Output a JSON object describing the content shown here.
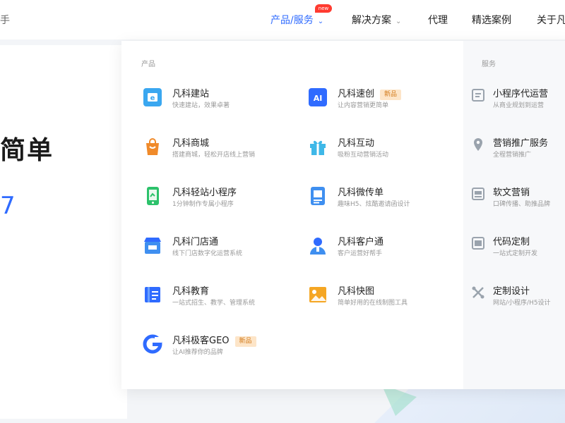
{
  "nav": {
    "brand_fragment": "手",
    "items": [
      {
        "label": "产品/服务",
        "has_chevron": true
      },
      {
        "label": "解决方案",
        "has_chevron": true
      },
      {
        "label": "代理",
        "has_chevron": false
      },
      {
        "label": "精选案例",
        "has_chevron": false
      },
      {
        "label": "关于凡",
        "has_chevron": false
      }
    ],
    "hot_badge": "new",
    "chevron": "⌄"
  },
  "hero": {
    "title_fragment": "简单",
    "number_fragment": "7"
  },
  "dropdown": {
    "products_label": "产品",
    "services_label": "服务",
    "products": [
      {
        "name": "凡科建站",
        "desc": "快速建站，效果卓著",
        "icon": "website-icon",
        "tag": ""
      },
      {
        "name": "凡科速创",
        "desc": "让内容营销更简单",
        "icon": "ai-icon",
        "tag": "新品"
      },
      {
        "name": "凡科商城",
        "desc": "搭建商城，轻松开店线上营销",
        "icon": "shopping-bag-icon",
        "tag": ""
      },
      {
        "name": "凡科互动",
        "desc": "吸粉互动营销活动",
        "icon": "gift-icon",
        "tag": ""
      },
      {
        "name": "凡科轻站小程序",
        "desc": "1分钟制作专属小程序",
        "icon": "mini-program-icon",
        "tag": ""
      },
      {
        "name": "凡科微传单",
        "desc": "趣味H5、炫酷邀请函设计",
        "icon": "flyer-icon",
        "tag": ""
      },
      {
        "name": "凡科门店通",
        "desc": "线下门店数字化运营系统",
        "icon": "store-icon",
        "tag": ""
      },
      {
        "name": "凡科客户通",
        "desc": "客户运营好帮手",
        "icon": "customer-icon",
        "tag": ""
      },
      {
        "name": "凡科教育",
        "desc": "一站式招生、教学、管理系统",
        "icon": "education-icon",
        "tag": ""
      },
      {
        "name": "凡科快图",
        "desc": "简单好用的在线制图工具",
        "icon": "image-icon",
        "tag": ""
      },
      {
        "name": "凡科极客GEO",
        "desc": "让AI推荐你的品牌",
        "icon": "geo-icon",
        "tag": "新品"
      }
    ],
    "services": [
      {
        "name": "小程序代运营",
        "desc": "从商业规划到运营",
        "icon": "mini-ops-icon"
      },
      {
        "name": "营销推广服务",
        "desc": "全程营销推广",
        "icon": "location-icon"
      },
      {
        "name": "软文营销",
        "desc": "口碑传播、助推品牌",
        "icon": "article-icon"
      },
      {
        "name": "代码定制",
        "desc": "一站式定制开发",
        "icon": "code-icon"
      },
      {
        "name": "定制设计",
        "desc": "网站/小程序/H5设计",
        "icon": "design-icon"
      }
    ]
  },
  "colors": {
    "accent": "#2f6bff",
    "new_tag_bg": "#fde5c8",
    "new_tag_text": "#d27a1a",
    "hot_badge": "#ff3b30"
  }
}
